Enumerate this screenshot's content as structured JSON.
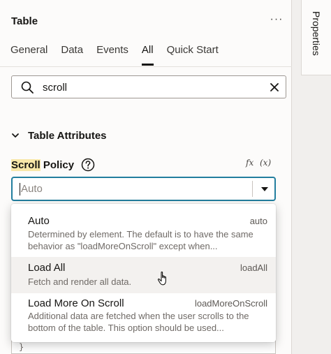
{
  "panel": {
    "title": "Table",
    "more_label": "···"
  },
  "tabs": [
    {
      "label": "General",
      "active": false
    },
    {
      "label": "Data",
      "active": false
    },
    {
      "label": "Events",
      "active": false
    },
    {
      "label": "All",
      "active": true
    },
    {
      "label": "Quick Start",
      "active": false
    }
  ],
  "search": {
    "value": "scroll",
    "icon": "search-icon",
    "clear_icon": "close-icon"
  },
  "section": {
    "label": "Table Attributes",
    "icon": "chevron-down-icon"
  },
  "property": {
    "label_highlight": "Scroll",
    "label_rest": " Policy",
    "help_icon": "help-circle-icon",
    "fx_label": "fx",
    "var_label": "(x)",
    "selected_value": "Auto"
  },
  "dropdown": {
    "options": [
      {
        "title": "Auto",
        "value": "auto",
        "description": "Determined by element. The default is to have the same behavior as \"loadMoreOnScroll\" except when..."
      },
      {
        "title": "Load All",
        "value": "loadAll",
        "description": "Fetch and render all data."
      },
      {
        "title": "Load More On Scroll",
        "value": "loadMoreOnScroll",
        "description": "Additional data are fetched when the user scrolls to the bottom of the table. This option should be used..."
      }
    ]
  },
  "behind": {
    "brace": "}"
  },
  "side_tab": {
    "label": "Properties"
  },
  "colors": {
    "focus_border": "#227e9e",
    "highlight": "#f8e7a8",
    "hover_row": "#f3f1ef"
  }
}
